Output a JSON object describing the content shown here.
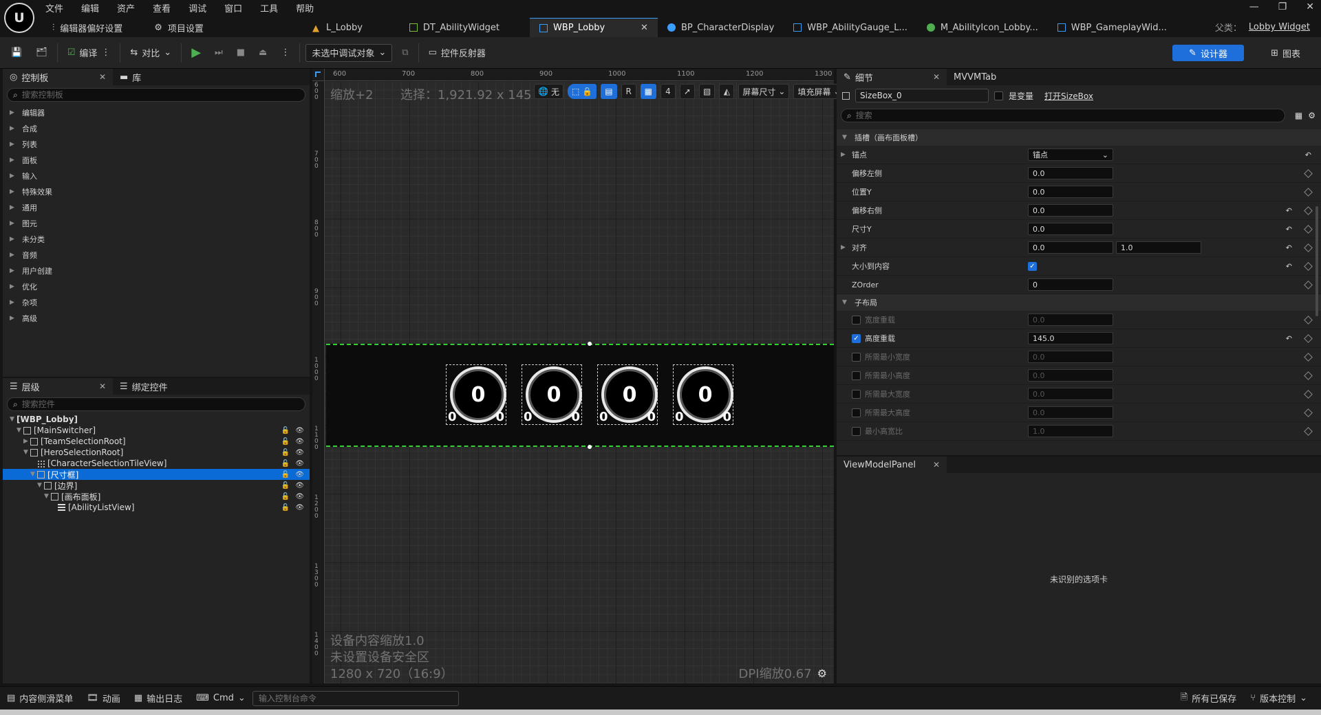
{
  "app": {
    "menu": [
      "文件",
      "编辑",
      "资产",
      "查看",
      "调试",
      "窗口",
      "工具",
      "帮助"
    ],
    "editor_prefs": "编辑器偏好设置",
    "project_settings": "项目设置",
    "parent_label": "父类：",
    "parent_class": "Lobby Widget"
  },
  "doc_tabs": [
    {
      "label": "L_Lobby",
      "icon_color": "#e0a030"
    },
    {
      "label": "DT_AbilityWidget",
      "icon_color": "#7fbf3f"
    },
    {
      "label": "WBP_Lobby",
      "icon_color": "#3a9eff"
    },
    {
      "label": "BP_CharacterDisplay",
      "icon_color": "#3a9eff"
    },
    {
      "label": "WBP_AbilityGauge_L...",
      "icon_color": "#3a9eff"
    },
    {
      "label": "M_AbilityIcon_Lobby...",
      "icon_color": "#4caf50"
    },
    {
      "label": "WBP_GameplayWid...",
      "icon_color": "#3a9eff"
    }
  ],
  "toolbar": {
    "compile": "编译",
    "diff": "对比",
    "debug_target": "未选中调试对象",
    "widget_reflector": "控件反射器",
    "designer": "设计器",
    "graph": "图表"
  },
  "palette": {
    "tab": "控制板",
    "library_tab": "库",
    "search_placeholder": "搜索控制板",
    "categories": [
      "编辑器",
      "合成",
      "列表",
      "面板",
      "输入",
      "特殊效果",
      "通用",
      "图元",
      "未分类",
      "音频",
      "用户创建",
      "优化",
      "杂项",
      "高级"
    ]
  },
  "hierarchy": {
    "tab": "层级",
    "bind_tab": "绑定控件",
    "search_placeholder": "搜索控件",
    "items": [
      {
        "label": "[WBP_Lobby]",
        "indent": 0,
        "expand": "▼",
        "icon": "none",
        "controls": false
      },
      {
        "label": "[MainSwitcher]",
        "indent": 1,
        "expand": "▼",
        "icon": "switcher",
        "controls": true
      },
      {
        "label": "[TeamSelectionRoot]",
        "indent": 2,
        "expand": "▶",
        "icon": "box",
        "controls": true
      },
      {
        "label": "[HeroSelectionRoot]",
        "indent": 2,
        "expand": "▼",
        "icon": "box",
        "controls": true
      },
      {
        "label": "[CharacterSelectionTileView]",
        "indent": 3,
        "expand": "",
        "icon": "tile",
        "controls": true
      },
      {
        "label": "[尺寸框]",
        "indent": 3,
        "expand": "▼",
        "icon": "box",
        "controls": true,
        "selected": true
      },
      {
        "label": "[边界]",
        "indent": 4,
        "expand": "▼",
        "icon": "box",
        "controls": true
      },
      {
        "label": "[画布面板]",
        "indent": 5,
        "expand": "▼",
        "icon": "box",
        "controls": true
      },
      {
        "label": "[AbilityListView]",
        "indent": 6,
        "expand": "",
        "icon": "list",
        "controls": true
      }
    ]
  },
  "designer": {
    "zoom": "缩放+2",
    "selection": "选择：1,921.92 x 145",
    "ruler_x": [
      "600",
      "700",
      "800",
      "900",
      "1000",
      "1100",
      "1200",
      "1300"
    ],
    "ruler_y": [
      "600",
      "700",
      "800",
      "900",
      "1000",
      "1100",
      "1200",
      "1300",
      "1400"
    ],
    "vp_none": "无",
    "vp_r": "R",
    "vp_grid_num": "4",
    "screen_size": "屏幕尺寸",
    "fill_screen": "填充屏幕",
    "device_scale": "设备内容缩放1.0",
    "no_safe_zone": "未设置设备安全区",
    "resolution": "1280 x 720（16:9）",
    "dpi": "DPI缩放0.67",
    "circles": [
      {
        "big": "0",
        "left": "0",
        "right": "0"
      },
      {
        "big": "0",
        "left": "0",
        "right": "0"
      },
      {
        "big": "0",
        "left": "0",
        "right": "0"
      },
      {
        "big": "0",
        "left": "0",
        "right": "0"
      }
    ]
  },
  "details": {
    "tab": "细节",
    "mvvm_tab": "MVVMTab",
    "widget_name": "SizeBox_0",
    "is_variable": "是变量",
    "open_link": "打开SizeBox",
    "search_placeholder": "搜索",
    "slot_section": "插槽（画布面板槽）",
    "anchor_label": "锚点",
    "anchor_value": "锚点",
    "offset_left_label": "偏移左侧",
    "offset_left": "0.0",
    "pos_y_label": "位置Y",
    "pos_y": "0.0",
    "offset_right_label": "偏移右侧",
    "offset_right": "0.0",
    "size_y_label": "尺寸Y",
    "size_y": "0.0",
    "align_label": "对齐",
    "align_x": "0.0",
    "align_y": "1.0",
    "size_to_content_label": "大小到内容",
    "zorder_label": "ZOrder",
    "zorder": "0",
    "child_layout_section": "子布局",
    "width_override_label": "宽度重载",
    "width_override": "0.0",
    "height_override_label": "高度重载",
    "height_override": "145.0",
    "min_width_label": "所需最小宽度",
    "min_width": "0.0",
    "min_height_label": "所需最小高度",
    "min_height": "0.0",
    "max_width_label": "所需最大宽度",
    "max_width": "0.0",
    "max_height_label": "所需最大高度",
    "max_height": "0.0",
    "min_aspect_label": "最小高宽比",
    "min_aspect": "1.0"
  },
  "viewmodel": {
    "tab": "ViewModelPanel",
    "message": "未识别的选项卡"
  },
  "statusbar": {
    "content_drawer": "内容侧滑菜单",
    "animation": "动画",
    "output_log": "输出日志",
    "cmd": "Cmd",
    "console_placeholder": "输入控制台命令",
    "all_saved": "所有已保存",
    "source_control": "版本控制"
  }
}
